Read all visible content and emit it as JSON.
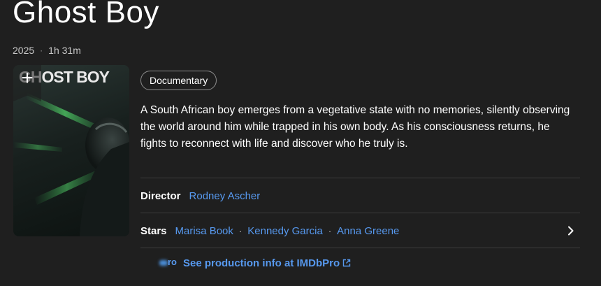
{
  "title": "Ghost Boy",
  "meta": {
    "year": "2025",
    "separator": "·",
    "runtime": "1h 31m"
  },
  "poster": {
    "title_text": "GHOST BOY",
    "add_icon": "plus-icon"
  },
  "genres": [
    "Documentary"
  ],
  "plot": "A South African boy emerges from a vegetative state with no memories, silently observing the world around him while trapped in his own body. As his consciousness returns, he fights to reconnect with life and discover who he truly is.",
  "credits": {
    "director": {
      "label": "Director",
      "names": [
        "Rodney Ascher"
      ]
    },
    "stars": {
      "label": "Stars",
      "names": [
        "Marisa Book",
        "Kennedy Garcia",
        "Anna Greene"
      ],
      "separator": "·",
      "more_icon": "chevron-right-icon"
    }
  },
  "imdbpro": {
    "logo_text": "ro",
    "link_text": "See production info at IMDbPro",
    "icon": "external-link-icon"
  },
  "colors": {
    "background": "#1f1f1f",
    "link": "#5799ef",
    "divider": "#3d3d3d"
  }
}
